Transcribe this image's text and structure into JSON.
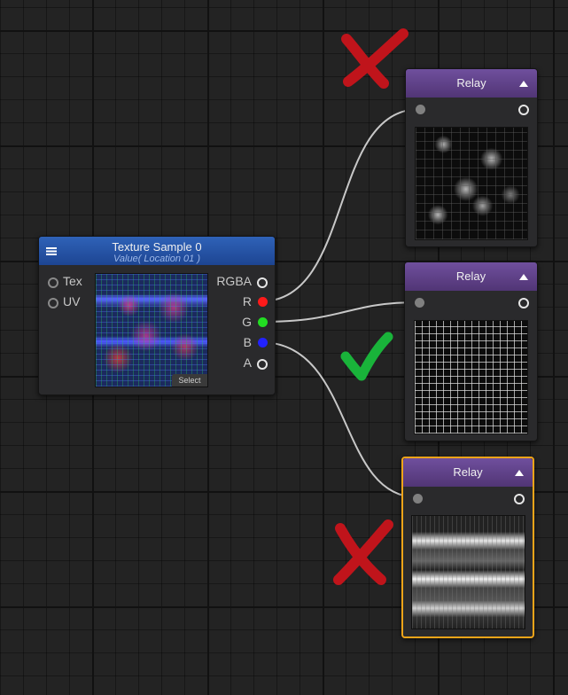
{
  "texture_node": {
    "title": "Texture Sample 0",
    "subtitle": "Value( Location 01 )",
    "inputs": [
      "Tex",
      "UV"
    ],
    "outputs": [
      "RGBA",
      "R",
      "G",
      "B",
      "A"
    ],
    "select_label": "Select",
    "output_colors": {
      "R": "#ff1a1a",
      "G": "#22dd22",
      "B": "#2222ff"
    }
  },
  "relay_nodes": [
    {
      "title": "Relay",
      "selected": false,
      "mark": "cross-icon"
    },
    {
      "title": "Relay",
      "selected": false,
      "mark": "check-icon"
    },
    {
      "title": "Relay",
      "selected": true,
      "mark": "cross-icon"
    }
  ],
  "colors": {
    "cross": "#c0141b",
    "check": "#19b33a",
    "selection": "#f0a419",
    "wire": "#c8c8c8"
  }
}
